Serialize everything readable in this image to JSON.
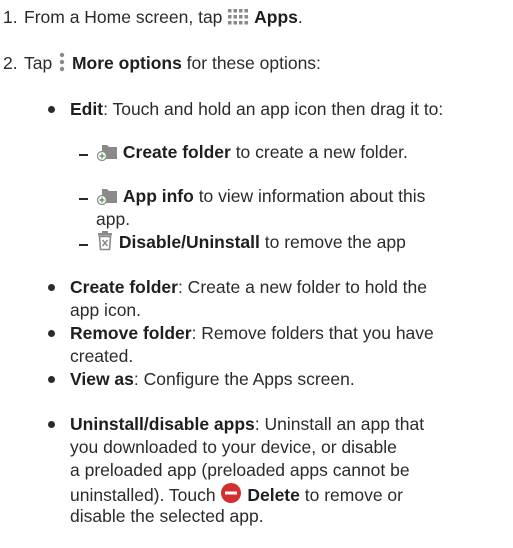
{
  "steps": [
    {
      "num": "1.",
      "pre": "From a Home screen, tap ",
      "icon": "apps-grid-icon",
      "bold": "Apps",
      "post": "."
    },
    {
      "num": "2.",
      "pre": "Tap ",
      "icon": "more-options-icon",
      "bold": "More options",
      "post": " for these options:"
    }
  ],
  "bullets": {
    "edit": {
      "bold": "Edit",
      "text": ": Touch and hold an app icon then drag it to:"
    },
    "create_folder": {
      "bold": "Create folder",
      "text": ": Create a new folder to hold the",
      "text2": "app icon."
    },
    "remove_folder": {
      "bold": "Remove folder",
      "text": ": Remove folders that you have",
      "text2": "created."
    },
    "view_as": {
      "bold": "View as",
      "text": ": Configure the Apps screen."
    },
    "uninstall": {
      "bold": "Uninstall/disable apps",
      "text": ": Uninstall an app that",
      "line2": "you downloaded to your device, or disable",
      "line3": "a preloaded app (preloaded apps cannot be",
      "line4_pre": "uninstalled). Touch ",
      "line4_icon": "delete-minus-icon",
      "line4_bold": "Delete",
      "line4_post": " to remove or",
      "line5": "disable the selected app."
    }
  },
  "sub_items": [
    {
      "icon": "folder-add-icon",
      "bold": "Create folder",
      "text": " to create a new folder."
    },
    {
      "icon": "folder-add-icon",
      "bold": "App info",
      "text": " to view information about this",
      "text2": "app."
    },
    {
      "icon": "trash-icon",
      "bold": "Disable/Uninstall",
      "text": " to remove the app"
    }
  ],
  "colors": {
    "text": "#2b2b2b",
    "icon_gray": "#8a8a8a",
    "icon_green": "#5aa05a",
    "delete_red": "#d32f2f"
  }
}
